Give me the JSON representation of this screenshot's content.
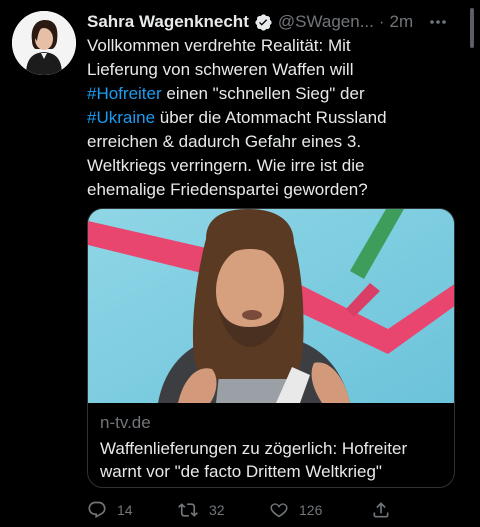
{
  "tweet": {
    "author_name": "Sahra Wagenknecht",
    "handle": "@SWagen...",
    "separator": "·",
    "time": "2m",
    "text_lines": [
      {
        "before": "Vollkommen verdrehte Realität: Mit",
        "tag": "",
        "after": ""
      },
      {
        "before": "Lieferung von schweren Waffen will",
        "tag": "",
        "after": ""
      },
      {
        "before": "",
        "tag": "#Hofreiter",
        "after": " einen \"schnellen Sieg\" der"
      },
      {
        "before": "",
        "tag": "#Ukraine",
        "after": " über die Atommacht Russland"
      },
      {
        "before": "erreichen & dadurch Gefahr eines 3.",
        "tag": "",
        "after": ""
      },
      {
        "before": "Weltkriegs verringern. Wie irre ist die",
        "tag": "",
        "after": ""
      },
      {
        "before": "ehemalige Friedenspartei geworden?",
        "tag": "",
        "after": ""
      }
    ]
  },
  "card": {
    "domain": "n-tv.de",
    "title_lines": [
      "Waffenlieferungen zu zögerlich: Hofreiter",
      "warnt vor \"de facto Drittem Weltkrieg\""
    ]
  },
  "actions": {
    "reply_count": "14",
    "retweet_count": "32",
    "like_count": "126"
  },
  "icons": {
    "verified": "verified-badge-icon",
    "more": "more-dots-icon",
    "reply": "reply-icon",
    "retweet": "retweet-icon",
    "like": "heart-icon",
    "share": "share-icon"
  },
  "colors": {
    "background": "#000000",
    "text": "#e7e9ea",
    "secondary": "#71767b",
    "link": "#1d9bf0",
    "border": "#2f3336"
  }
}
